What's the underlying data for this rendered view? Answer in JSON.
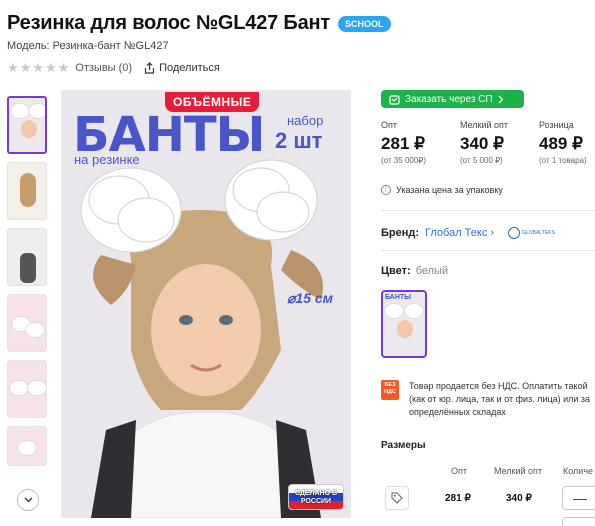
{
  "product": {
    "title": "Резинка для волос №GL427 Бант",
    "badge": "SCHOOL",
    "model": "Модель: Резинка-бант №GL427"
  },
  "meta": {
    "reviews": "Отзывы (0)",
    "share": "Поделиться",
    "rating_stars": 0,
    "max_stars": 5
  },
  "gallery": {
    "thumbnails": 7,
    "active_index": 0
  },
  "main_image": {
    "volume_tag": "ОБЪЁМНЫЕ",
    "headline": "БАНТЫ",
    "subline": "на резинке",
    "set_label": "набор",
    "count_label": "2 шт",
    "diameter": "⌀15 см",
    "made_in": "СДЕЛАНО В РОССИИ"
  },
  "sp_button": {
    "label": "Заказать через СП"
  },
  "prices": [
    {
      "label": "Опт",
      "price": "281 ₽",
      "note": "(от 35 000₽)"
    },
    {
      "label": "Мелкий опт",
      "price": "340 ₽",
      "note": "(от 5 000 ₽)"
    },
    {
      "label": "Розница",
      "price": "489 ₽",
      "note": "(от 1 товара)"
    }
  ],
  "pack_note": "Указана цена за упаковку",
  "brand": {
    "label": "Бренд:",
    "value": "Глобал Текс",
    "logo_text": "GLOBALTEKS"
  },
  "color": {
    "label": "Цвет:",
    "value": "белый"
  },
  "vat": {
    "icon_text": "БЕЗ НДС",
    "lines": [
      "Товар продается без НДС. Оплатить такой",
      "(как от юр. лица, так и от физ. лица) или за",
      "определённых складах"
    ]
  },
  "sizes": {
    "title": "Размеры",
    "headers": [
      "Опт",
      "Мелкий опт",
      "Количе"
    ],
    "row": {
      "opt": "281 ₽",
      "small_opt": "340 ₽",
      "qty": "—"
    }
  },
  "colors": {
    "accent_purple": "#7a38d6",
    "green": "#1fb24b",
    "badge_blue": "#2aa6f0",
    "link_blue": "#2b6fd9",
    "red_tag": "#e21e3c"
  }
}
